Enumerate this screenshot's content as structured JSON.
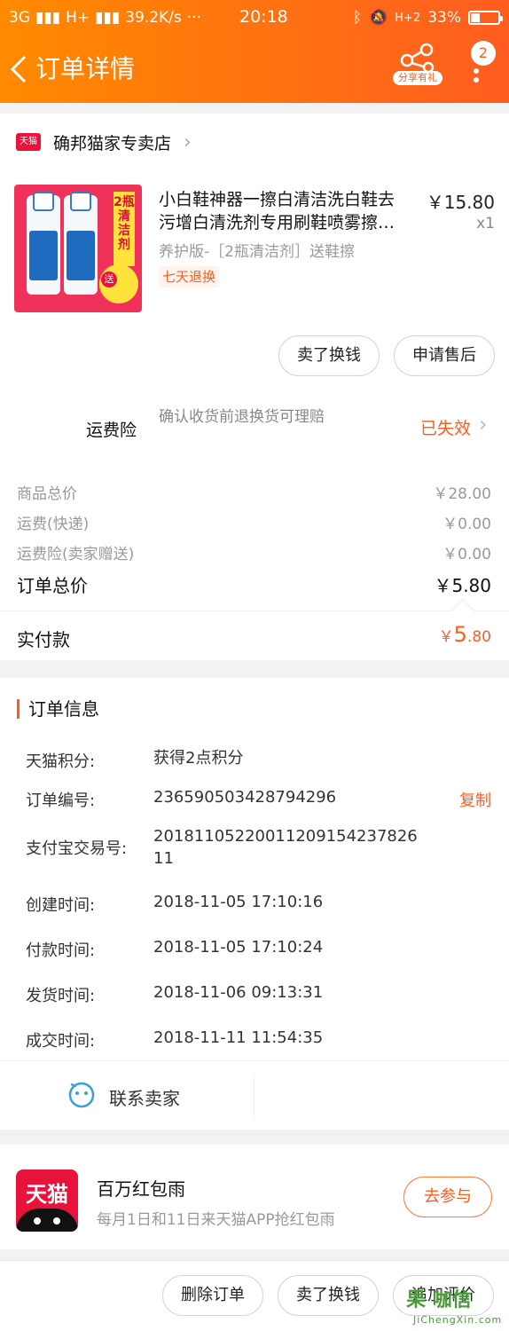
{
  "status_bar": {
    "network": "3G",
    "network2": "H+",
    "speed": "39.2K/s",
    "dots": "···",
    "time": "20:18",
    "signal_right": "H+2",
    "battery": "33%",
    "battery_level": 0.33
  },
  "nav": {
    "title": "订单详情",
    "share_label": "分享有礼",
    "badge_count": "2"
  },
  "shop": {
    "tag": "天猫",
    "name": "确邦猫家专卖店"
  },
  "product": {
    "title_line1": "小白鞋神器一擦白清洁洗白鞋去",
    "title_line2": "污增白清洗剂专用刷鞋喷雾擦…",
    "price": "￥15.80",
    "quantity": "x1",
    "spec": "养护版-［2瓶清洁剂］送鞋擦",
    "return_tag": "七天退换",
    "image_strip_text": "2瓶清洁剂",
    "image_badge": "送"
  },
  "product_actions": {
    "sell_label": "卖了换钱",
    "after_sale_label": "申请售后"
  },
  "insurance": {
    "label": "运费险",
    "desc": "确认收货前退换货可理赔",
    "status": "已失效"
  },
  "costs": [
    {
      "label": "商品总价",
      "value": "￥28.00"
    },
    {
      "label": "运费(快递)",
      "value": "￥0.00"
    },
    {
      "label": "运费险(卖家赠送)",
      "value": "￥0.00"
    }
  ],
  "order_total": {
    "label": "订单总价",
    "value": "￥5.80"
  },
  "paid": {
    "label": "实付款",
    "currency": "￥",
    "int": "5",
    "dec": ".80"
  },
  "order_info": {
    "title": "订单信息",
    "rows": [
      {
        "label": "天猫积分:",
        "value": "获得2点积分"
      },
      {
        "label": "订单编号:",
        "value": "236590503428794296",
        "action": "复制"
      },
      {
        "label": "支付宝交易号:",
        "value": "2018110522001120915423782611"
      },
      {
        "label": "创建时间:",
        "value": "2018-11-05 17:10:16"
      },
      {
        "label": "付款时间:",
        "value": "2018-11-05 17:10:24"
      },
      {
        "label": "发货时间:",
        "value": "2018-11-06 09:13:31"
      },
      {
        "label": "成交时间:",
        "value": "2018-11-11 11:54:35"
      }
    ]
  },
  "contact": {
    "label": "联系卖家"
  },
  "promo": {
    "icon_text": "天猫",
    "title": "百万红包雨",
    "subtitle": "每月1日和11日来天猫APP抢红包雨",
    "button": "去参与"
  },
  "bottom_bar": {
    "delete_label": "删除订单",
    "sell_label": "卖了换钱",
    "review_label": "追加评价"
  },
  "watermark": {
    "main": "果 咖信",
    "sub": "JiChengXin.com"
  },
  "colors": {
    "accent": "#ff5d1f",
    "header_start": "#ff8a00",
    "tmall_red": "#e8123a"
  }
}
